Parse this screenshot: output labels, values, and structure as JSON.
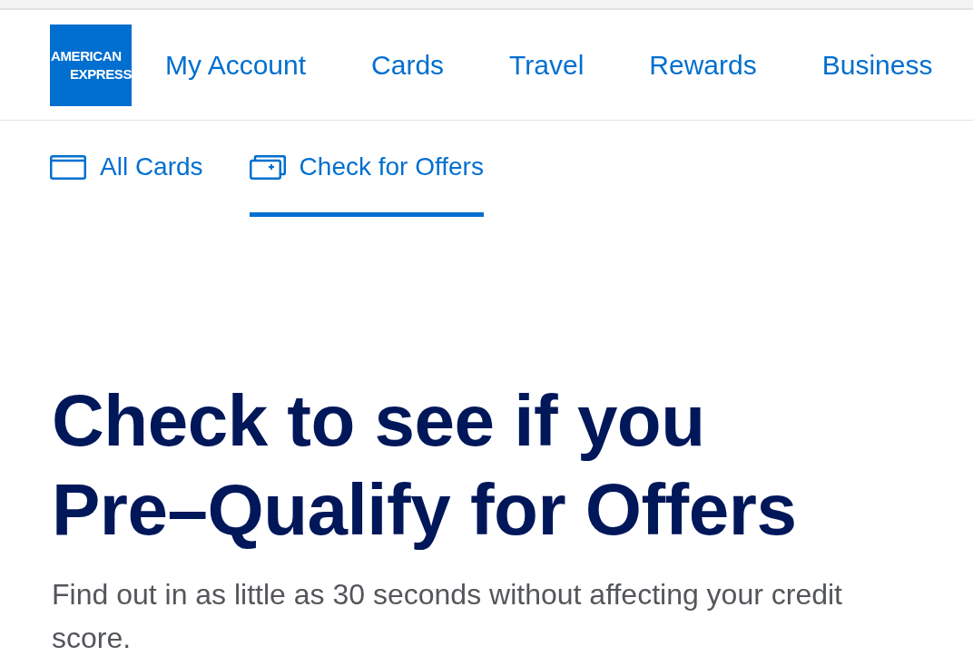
{
  "logo": {
    "lines": [
      "AMERICAN",
      "EXPRESS"
    ]
  },
  "nav": [
    "My Account",
    "Cards",
    "Travel",
    "Rewards",
    "Business"
  ],
  "tabs": [
    {
      "label": "All Cards",
      "selected": false
    },
    {
      "label": "Check for Offers",
      "selected": true
    }
  ],
  "hero": {
    "title": "Check to see if you Pre–Qualify for Offers",
    "description": "Find out in as little as 30 seconds without affecting your credit score."
  }
}
